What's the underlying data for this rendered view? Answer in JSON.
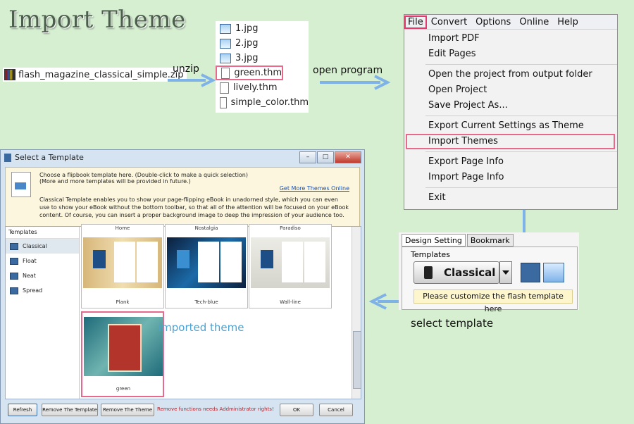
{
  "title": "Import Theme",
  "zip_file": "flash_magazine_classical_simple.zip",
  "labels": {
    "unzip": "unzip",
    "open_program": "open  program",
    "select_template": "select  template",
    "imported_theme": "imported  theme"
  },
  "files": [
    "1.jpg",
    "2.jpg",
    "3.jpg",
    "green.thm",
    "lively.thm",
    "simple_color.thm"
  ],
  "menu": {
    "bar": [
      "File",
      "Convert",
      "Options",
      "Online",
      "Help"
    ],
    "items": [
      "Import PDF",
      "Edit Pages",
      "Open the project from output folder",
      "Open Project",
      "Save Project As...",
      "Export Current Settings as Theme",
      "Import Themes",
      "Export Page Info",
      "Import Page Info",
      "Exit"
    ]
  },
  "dialog": {
    "title": "Select a Template",
    "window_buttons": [
      "–",
      "□",
      "✕"
    ],
    "info_line1": "Choose a flipbook template here. (Double-click to make a quick selection)",
    "info_line2": "(More and more templates will be provided in future.)",
    "get_more": "Get More Themes Online",
    "description": "Classical Template enables you to show your page-flipping eBook in unadorned style, which you can even use to show your eBook without the bottom toolbar, so that all of the attention will be focused on your eBook content. Of course, you can insert a proper background image to deep the impression of your audience too.",
    "templates_header": "Templates",
    "templates": [
      "Classical",
      "Float",
      "Neat",
      "Spread"
    ],
    "top_captions": [
      "Home",
      "Nostalgia",
      "Paradiso"
    ],
    "tiles": [
      "Plank",
      "Tech-blue",
      "Wall-line",
      "green"
    ],
    "buttons": {
      "refresh": "Refresh",
      "remove_template": "Remove The Template",
      "remove_theme": "Remove The Theme",
      "ok": "OK",
      "cancel": "Cancel"
    },
    "warning": "Remove functions needs Addministrator rights!"
  },
  "design": {
    "tabs": [
      "Design Setting",
      "Bookmark"
    ],
    "group": "Templates",
    "button": "Classical",
    "hint": "Please customize the flash template here"
  },
  "colors": {
    "background": "#d7efd1",
    "highlight": "#e23b6b",
    "arrow": "#7fb3e8",
    "accent_text": "#4aa3d4"
  }
}
